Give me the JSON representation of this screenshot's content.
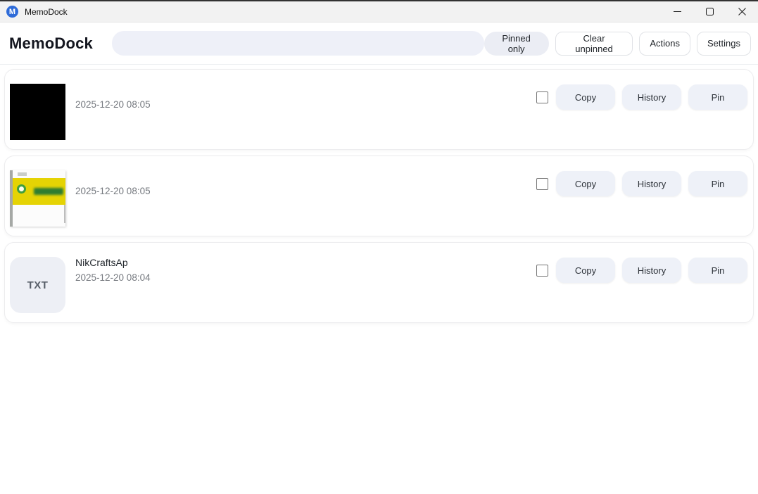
{
  "titlebar": {
    "app_name": "MemoDock",
    "app_icon_letter": "M"
  },
  "header": {
    "title": "MemoDock",
    "search": {
      "value": "",
      "placeholder": ""
    },
    "pinned_only_label": "Pinned only",
    "clear_unpinned_label": "Clear unpinned",
    "actions_label": "Actions",
    "settings_label": "Settings"
  },
  "item_actions": {
    "copy": "Copy",
    "history": "History",
    "pin": "Pin"
  },
  "items": [
    {
      "kind": "image",
      "thumbnail": "black-image",
      "title": "",
      "timestamp": "2025-12-20 08:05",
      "checked": false
    },
    {
      "kind": "image",
      "thumbnail": "yellow-logo-screenshot",
      "title": "",
      "timestamp": "2025-12-20 08:05",
      "checked": false
    },
    {
      "kind": "text",
      "badge": "TXT",
      "title": "NikCraftsAp",
      "timestamp": "2025-12-20 08:04",
      "checked": false
    }
  ],
  "colors": {
    "accent_blue": "#2e6bd8",
    "titlebar_bg": "#f2f2f2",
    "search_bg": "#eef0f8",
    "action_button_bg": "#eef1f8",
    "toggle_active_bg": "#ebedf4",
    "thumb_yellow": "#e5d304",
    "thumb_green": "#3f9f3f",
    "timestamp_gray": "#75797f"
  }
}
